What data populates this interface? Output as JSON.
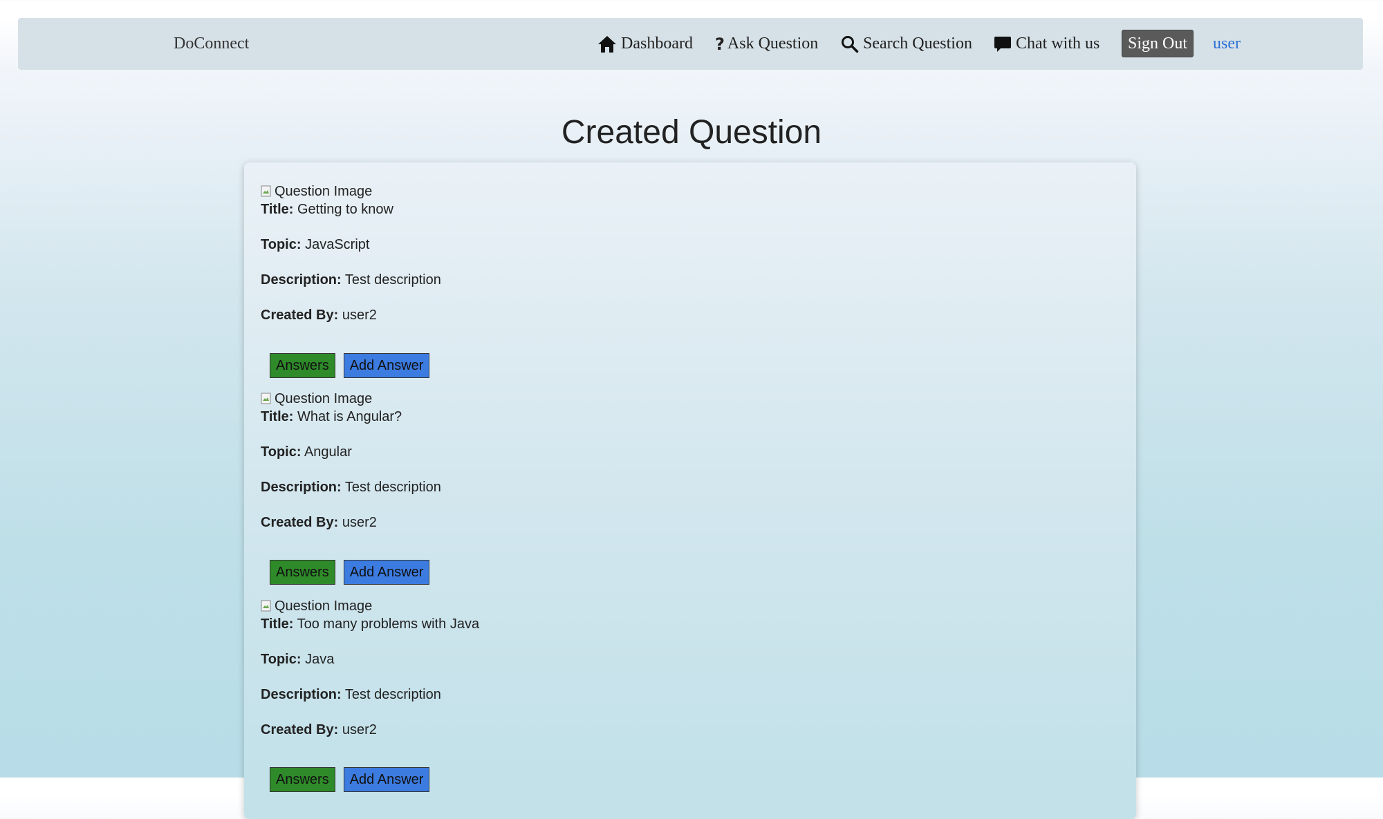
{
  "navbar": {
    "brand": "DoConnect",
    "items": [
      {
        "label": "Dashboard",
        "icon": "home-icon"
      },
      {
        "label": "Ask Question",
        "icon": "question-mark-icon"
      },
      {
        "label": "Search Question",
        "icon": "search-icon"
      },
      {
        "label": "Chat with us",
        "icon": "chat-bubble-icon"
      }
    ],
    "sign_out_label": "Sign Out",
    "user_label": "user"
  },
  "page": {
    "title": "Created Question"
  },
  "labels": {
    "title": "Title:",
    "topic": "Topic:",
    "description": "Description:",
    "created_by": "Created By:",
    "image_alt": "Question Image",
    "answers_button": "Answers",
    "add_answer_button": "Add Answer"
  },
  "questions": [
    {
      "title": "Getting to know",
      "topic": "JavaScript",
      "description": "Test description",
      "created_by": "user2"
    },
    {
      "title": "What is Angular?",
      "topic": "Angular",
      "description": "Test description",
      "created_by": "user2"
    },
    {
      "title": "Too many problems with Java",
      "topic": "Java",
      "description": "Test description",
      "created_by": "user2"
    }
  ],
  "colors": {
    "answers_button": "#2f8a2a",
    "add_answer_button": "#3c7be0",
    "sign_out_button": "#5a5a5a",
    "user_link": "#2b6fd6",
    "navbar_bg": "#d6e1e7"
  }
}
